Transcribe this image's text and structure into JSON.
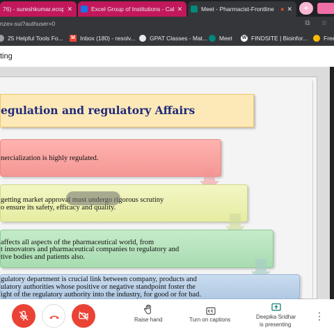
{
  "tabs": [
    {
      "title": "76) - sureshkumar.ecop@",
      "close": "✕",
      "favicon_color": "#d93025"
    },
    {
      "title": "Excel Group of Institutions - Cale",
      "close": "✕",
      "favicon_color": "#1a73e8"
    },
    {
      "title": "Meet - Pharmacist-Frontline",
      "close": "✕",
      "favicon_color": "#00897b",
      "recording": "●"
    }
  ],
  "new_tab": "+",
  "address_bar": {
    "url": "nzex-sui?authuser=0"
  },
  "bookmarks": [
    {
      "label": "25 Helpful Tools Fo...",
      "icon": "link-icon"
    },
    {
      "label": "Inbox (180) - resolv...",
      "icon": "gmail-icon"
    },
    {
      "label": "GPAT Classes - Mat...",
      "icon": "globe-icon"
    },
    {
      "label": "Meet",
      "icon": "meet-icon"
    },
    {
      "label": "FINDSITE | Bioinfor...",
      "icon": "wordpress-icon"
    },
    {
      "label": "Free",
      "icon": "site-icon"
    }
  ],
  "meeting": {
    "title_fragment": "ting"
  },
  "slide": {
    "title": "egulation and regulatory Affairs",
    "boxes": [
      {
        "lines": [
          "nercialization is highly regulated."
        ]
      },
      {
        "lines": [
          "getting market approval must undergo rigorous scrutiny",
          "o ensure its safety, efficacy and quality."
        ]
      },
      {
        "lines": [
          "affects all aspects of the pharmaceutical world, from",
          "t innovators and pharmaceutical companies to regulatory and",
          "tive bodies and patients also."
        ]
      },
      {
        "lines": [
          "gulatory department is crucial link between company, products and",
          "ulatory authorities whose positive or negative standpoint foster the",
          "ight of the regulatory authority into the industry, for good or for bad."
        ]
      }
    ]
  },
  "controls": {
    "raise_hand": "Raise hand",
    "captions": "Turn on captions",
    "presenter_line1": "Deepika Sridhar",
    "presenter_line2": "is presenting",
    "more": "⋮"
  },
  "colors": {
    "danger": "#ea4335",
    "tab_active": "#c2185b",
    "title_text": "#1f2a7a"
  }
}
